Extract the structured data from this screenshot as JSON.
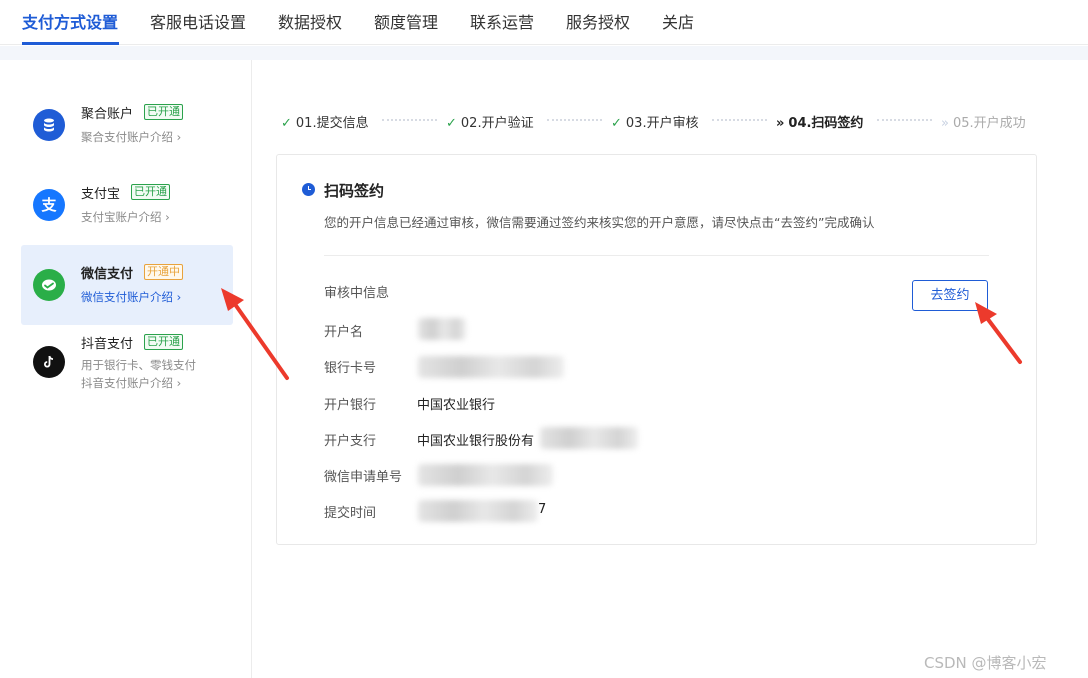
{
  "topnav": {
    "tabs": [
      {
        "label": "支付方式设置",
        "active": true
      },
      {
        "label": "客服电话设置"
      },
      {
        "label": "数据授权"
      },
      {
        "label": "额度管理"
      },
      {
        "label": "联系运营"
      },
      {
        "label": "服务授权"
      },
      {
        "label": "关店"
      }
    ]
  },
  "sidebar": {
    "items": [
      {
        "name": "聚合账户",
        "badge": "已开通",
        "badge_color": "#2ba24c",
        "sub": "聚合支付账户介绍 ›",
        "icon": "database-icon",
        "icon_color": "#1f5cd6"
      },
      {
        "name": "支付宝",
        "badge": "已开通",
        "badge_color": "#2ba24c",
        "sub": "支付宝账户介绍 ›",
        "icon": "alipay-icon",
        "icon_color": "#1677ff"
      },
      {
        "name": "微信支付",
        "badge": "开通中",
        "badge_color": "#e8a33d",
        "sub": "微信支付账户介绍 ›",
        "icon": "wechat-icon",
        "icon_color": "#2aae48",
        "active": true
      },
      {
        "name": "抖音支付",
        "badge": "已开通",
        "badge_color": "#2ba24c",
        "sub1": "用于银行卡、零钱支付",
        "sub": "抖音支付账户介绍 ›",
        "icon": "tiktok-icon",
        "icon_color": "#111111"
      }
    ]
  },
  "steps": [
    {
      "mark": "✓",
      "label": "01.提交信息",
      "status": "done"
    },
    {
      "mark": "✓",
      "label": "02.开户验证",
      "status": "done"
    },
    {
      "mark": "✓",
      "label": "03.开户审核",
      "status": "done"
    },
    {
      "mark": "»",
      "label": "04.扫码签约",
      "status": "current"
    },
    {
      "mark": "»",
      "label": "05.开户成功",
      "status": "pending"
    }
  ],
  "card": {
    "title": "扫码签约",
    "desc": "您的开户信息已经通过审核，微信需要通过签约来核实您的开户意愿，请尽快点击“去签约”完成确认",
    "section_label": "审核中信息",
    "sign_button": "去签约",
    "rows": [
      {
        "label": "开户名",
        "value": ""
      },
      {
        "label": "银行卡号",
        "value": ""
      },
      {
        "label": "开户银行",
        "value": "中国农业银行"
      },
      {
        "label": "开户支行",
        "value": "中国农业银行股份有"
      },
      {
        "label": "微信申请单号",
        "value": ""
      },
      {
        "label": "提交时间",
        "value": "7"
      }
    ]
  },
  "watermark": "CSDN @博客小宏",
  "colors": {
    "accent": "#1f5cd6",
    "annotation_arrow": "#ec3a2c"
  }
}
